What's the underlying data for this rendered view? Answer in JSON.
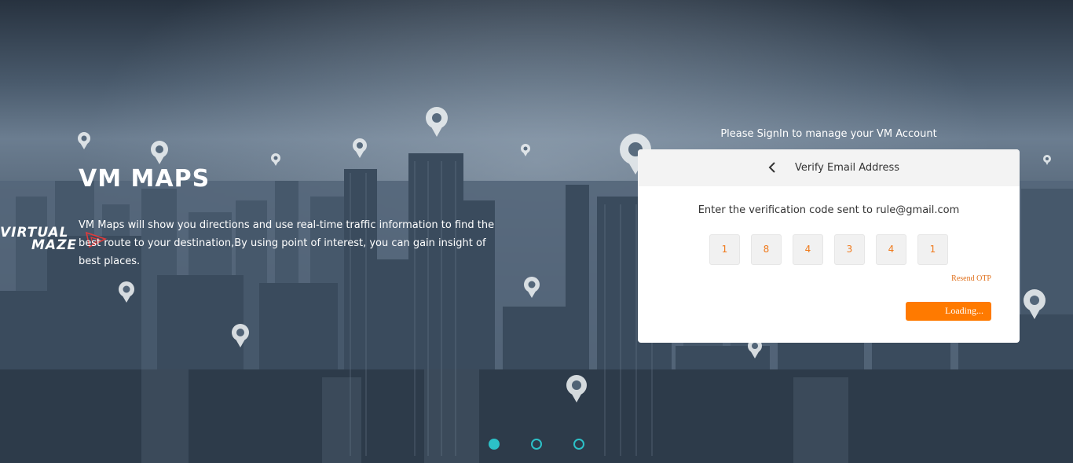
{
  "brand": {
    "logo_line1": "VIRTUAL",
    "logo_line2": "MAZE",
    "accent_color": "#ff7a00",
    "dot_color": "#2cc1c8"
  },
  "hero": {
    "title": "VM MAPS",
    "description": "VM Maps will show you directions and use real-time traffic information to find the best route to your destination,By using point of interest, you can gain insight of best places."
  },
  "signin": {
    "caption": "Please SignIn to manage your VM Account"
  },
  "verify": {
    "back_icon": "chevron-left-icon",
    "title": "Verify Email Address",
    "instruction": "Enter the verification code sent to rule@gmail.com",
    "otp": [
      "1",
      "8",
      "4",
      "3",
      "4",
      "1"
    ],
    "resend_label": "Resend OTP",
    "submit_label": "Loading..."
  },
  "carousel": {
    "slides": 3,
    "active_index": 0
  }
}
